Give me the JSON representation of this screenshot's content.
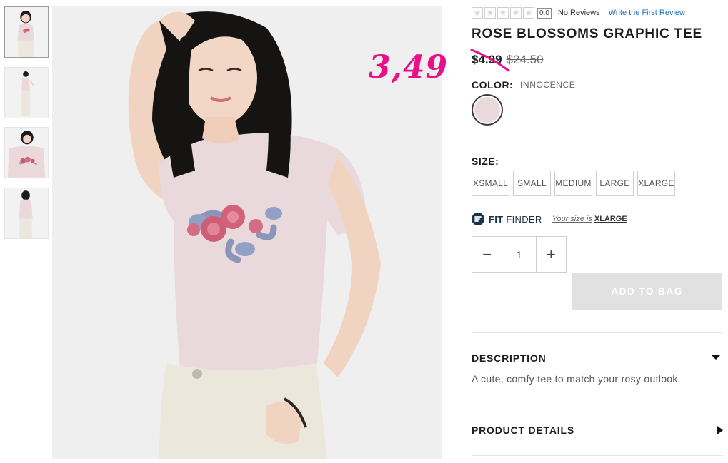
{
  "product": {
    "title": "ROSE BLOSSOMS GRAPHIC TEE",
    "price_sale": "$4.99",
    "price_original": "$24.50",
    "overlay_price": "3,49"
  },
  "reviews": {
    "stars_filled": 0,
    "stars_total": 5,
    "rating": "0.0",
    "count_text": "No Reviews",
    "write_link": "Write the First Review"
  },
  "color": {
    "label": "COLOR:",
    "name": "INNOCENCE",
    "swatch_hex": "#e7d9dc"
  },
  "size": {
    "label": "SIZE:",
    "options": [
      "XSMALL",
      "SMALL",
      "MEDIUM",
      "LARGE",
      "XLARGE"
    ]
  },
  "fit_finder": {
    "fit": "FIT",
    "finder": "FINDER",
    "size_text": "Your size is",
    "size_value": "XLARGE"
  },
  "quantity": {
    "minus": "−",
    "value": "1",
    "plus": "+"
  },
  "add_to_bag": "ADD TO BAG",
  "description": {
    "title": "DESCRIPTION",
    "text": "A cute, comfy tee to match your rosy outlook."
  },
  "product_details": {
    "title": "PRODUCT DETAILS"
  },
  "colors": {
    "overlay_pink": "#ea0f86",
    "link_blue": "#1f6ec0",
    "fit_navy": "#18344a",
    "disabled_button": "#e1e1e1"
  }
}
